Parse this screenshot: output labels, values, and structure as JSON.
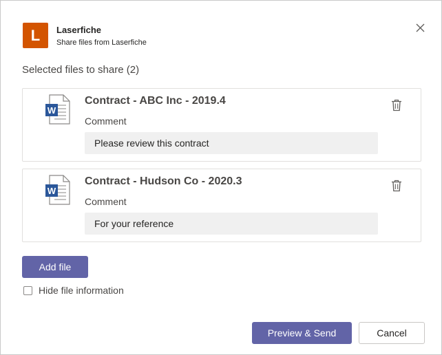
{
  "header": {
    "logo_letter": "L",
    "app_name": "Laserfiche",
    "subtitle": "Share files from Laserfiche"
  },
  "section_title": "Selected files to share (2)",
  "files": [
    {
      "title": "Contract - ABC Inc - 2019.4",
      "comment_label": "Comment",
      "comment_value": "Please review this contract",
      "icon": "word-document-icon"
    },
    {
      "title": "Contract - Hudson Co - 2020.3",
      "comment_label": "Comment",
      "comment_value": "For your reference",
      "icon": "word-document-icon"
    }
  ],
  "actions": {
    "add_file": "Add file",
    "hide_info": "Hide file information",
    "hide_info_checked": false,
    "preview_send": "Preview & Send",
    "cancel": "Cancel"
  },
  "colors": {
    "primary": "#6264a7",
    "logo": "#d35400",
    "word_blue": "#2b579a"
  }
}
